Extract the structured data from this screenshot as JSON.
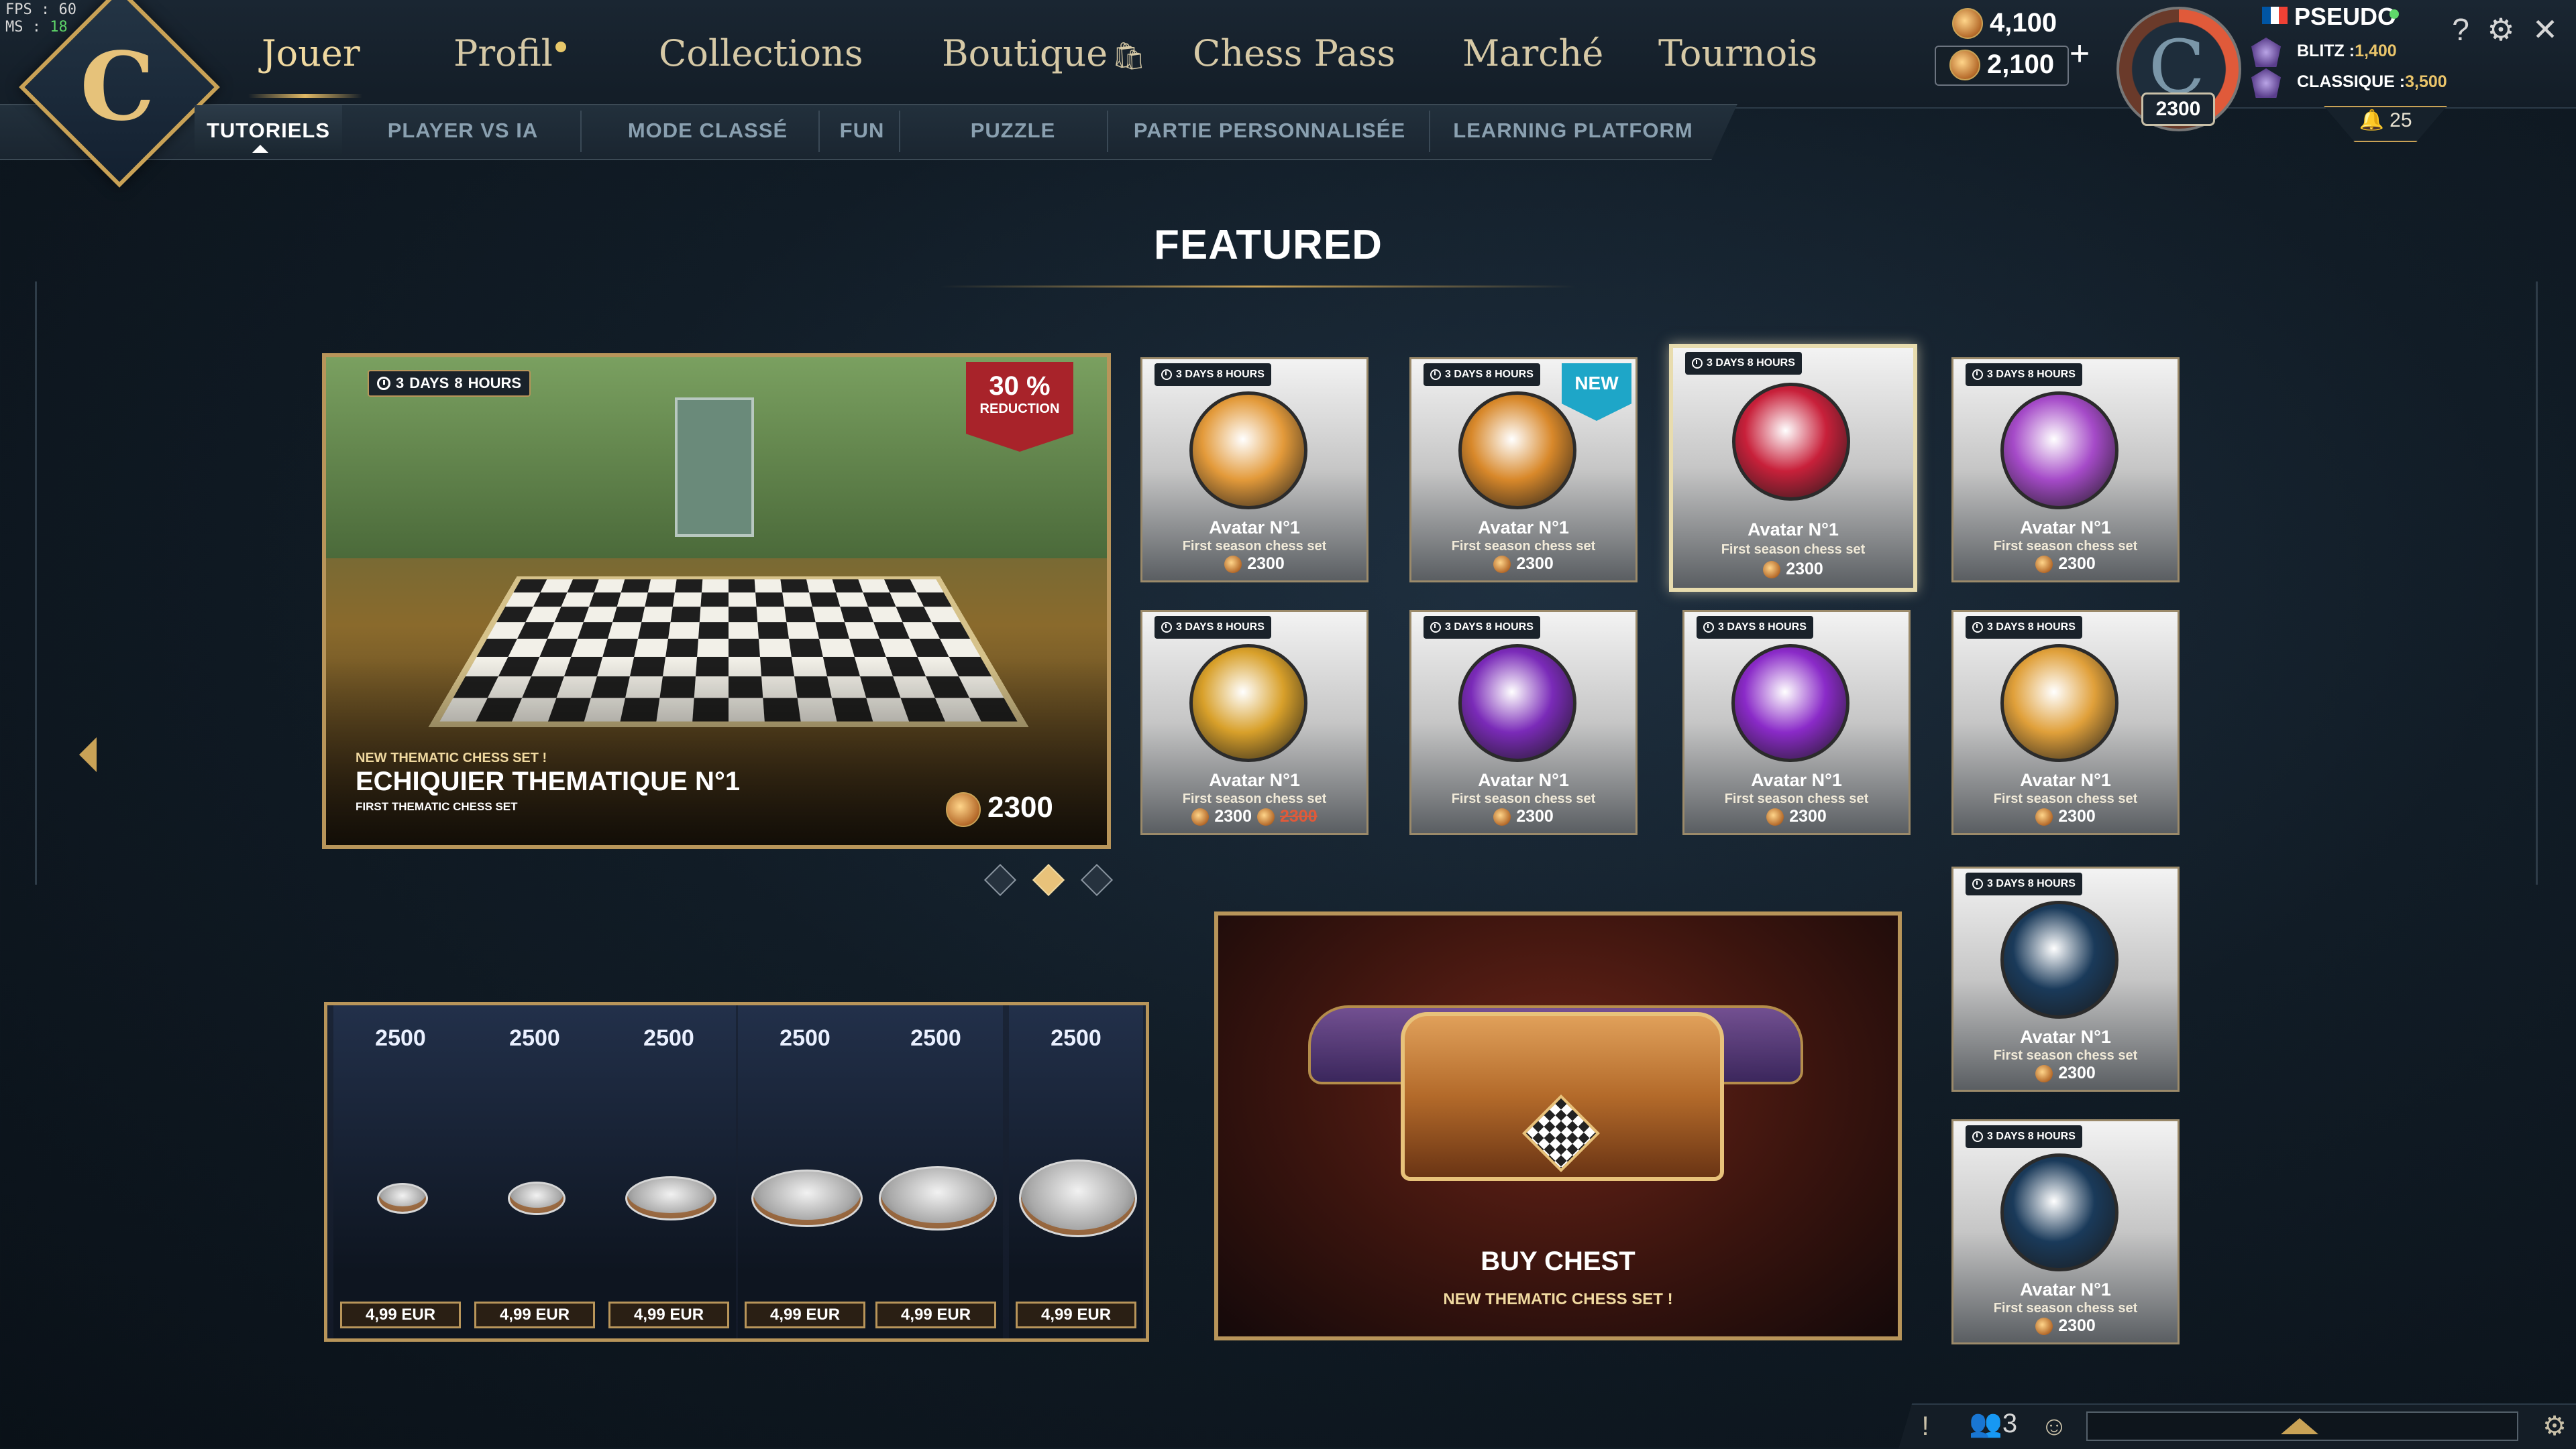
{
  "debug": {
    "fps_label": "FPS :",
    "fps": "60",
    "ms_label": "MS :",
    "ms": "18"
  },
  "nav": {
    "tabs": [
      "Jouer",
      "Profil",
      "Collections",
      "Boutique",
      "Chess Pass",
      "Marché",
      "Tournois"
    ],
    "active": "Jouer"
  },
  "subnav": {
    "tabs": [
      "TUTORIELS",
      "PLAYER VS IA",
      "MODE CLASSÉ",
      "FUN",
      "PUZZLE",
      "PARTIE PERSONNALISÉE",
      "LEARNING PLATFORM"
    ],
    "active": "TUTORIELS"
  },
  "currency": {
    "primary": "4,100",
    "secondary": "2,100"
  },
  "profile": {
    "elo": "2300",
    "pseudo": "PSEUDO",
    "blitz_label": "BLITZ :",
    "blitz": "1,400",
    "classique_label": "CLASSIQUE :",
    "classique": "3,500",
    "notifications": "25",
    "flag_colors": [
      "#0055A4",
      "#FFFFFF",
      "#EF4135"
    ]
  },
  "featured": {
    "title": "FEATURED",
    "banner": {
      "timer_num": "3",
      "timer_days": "DAYS",
      "timer_hours_num": "8",
      "timer_hours": "HOURS",
      "reduction_pct": "30 %",
      "reduction_label": "REDUCTION",
      "kicker": "NEW THEMATIC CHESS SET !",
      "title": "ECHIQUIER THEMATIQUE N°1",
      "subtitle": "FIRST THEMATIC CHESS SET",
      "price": "2300"
    },
    "carousel_active_index": 1,
    "cards": [
      {
        "timer": "3 DAYS 8 HOURS",
        "name": "Avatar N°1",
        "desc": "First season chess set",
        "price": "2300",
        "color": "#e39a3a"
      },
      {
        "timer": "3 DAYS 8 HOURS",
        "name": "Avatar N°1",
        "desc": "First season chess set",
        "price": "2300",
        "color": "#d8882a",
        "badge": "NEW"
      },
      {
        "timer": "3 DAYS 8 HOURS",
        "name": "Avatar N°1",
        "desc": "First season chess set",
        "price": "2300",
        "color": "#c8203a",
        "highlight": true
      },
      {
        "timer": "3 DAYS 8 HOURS",
        "name": "Avatar N°1",
        "desc": "First season chess set",
        "price": "2300",
        "color": "#a54ac8"
      },
      {
        "timer": "3 DAYS 8 HOURS",
        "name": "Avatar N°1",
        "desc": "First season chess set",
        "price": "2300",
        "old_price": "2300",
        "color": "#d8a02a"
      },
      {
        "timer": "3 DAYS 8 HOURS",
        "name": "Avatar N°1",
        "desc": "First season chess set",
        "price": "2300",
        "color": "#7a2ab8"
      },
      {
        "timer": "3 DAYS 8 HOURS",
        "name": "Avatar N°1",
        "desc": "First season chess set",
        "price": "2300",
        "color": "#8a2ac8"
      },
      {
        "timer": "3 DAYS 8 HOURS",
        "name": "Avatar N°1",
        "desc": "First season chess set",
        "price": "2300",
        "color": "#e0a03a"
      },
      {
        "timer": "3 DAYS 8 HOURS",
        "name": "Avatar N°1",
        "desc": "First season chess set",
        "price": "2300",
        "color": "#1a3a5a"
      },
      {
        "timer": "3 DAYS 8 HOURS",
        "name": "Avatar N°1",
        "desc": "First season chess set",
        "price": "2300",
        "color": "#1a3a5a"
      }
    ]
  },
  "packs": [
    {
      "amount": "2500",
      "price": "4,99 EUR"
    },
    {
      "amount": "2500",
      "price": "4,99 EUR"
    },
    {
      "amount": "2500",
      "price": "4,99 EUR"
    },
    {
      "amount": "2500",
      "price": "4,99 EUR"
    },
    {
      "amount": "2500",
      "price": "4,99 EUR"
    },
    {
      "amount": "2500",
      "price": "4,99 EUR"
    }
  ],
  "chest": {
    "title": "BUY CHEST",
    "subtitle": "NEW THEMATIC CHESS SET !"
  },
  "bottom": {
    "friends_count": "3"
  },
  "colors": {
    "gold": "#c9a256",
    "accent_new": "#1ea6c8",
    "reduction": "#a8232a"
  }
}
